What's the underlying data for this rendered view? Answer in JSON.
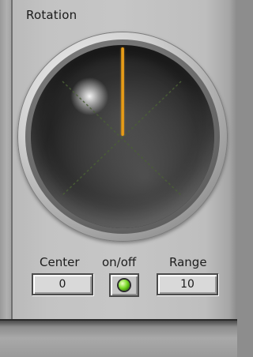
{
  "title": "Rotation",
  "knob": {
    "icon": "rotation-knob",
    "needle_icon": "needle-indicator",
    "needle_color": "#F2A51C",
    "angle_degrees": 0
  },
  "controls": {
    "center_label": "Center",
    "center_value": "0",
    "onoff_label": "on/off",
    "onoff_state": "on",
    "led_color": "#7CDB2A",
    "range_label": "Range",
    "range_value": "10"
  }
}
